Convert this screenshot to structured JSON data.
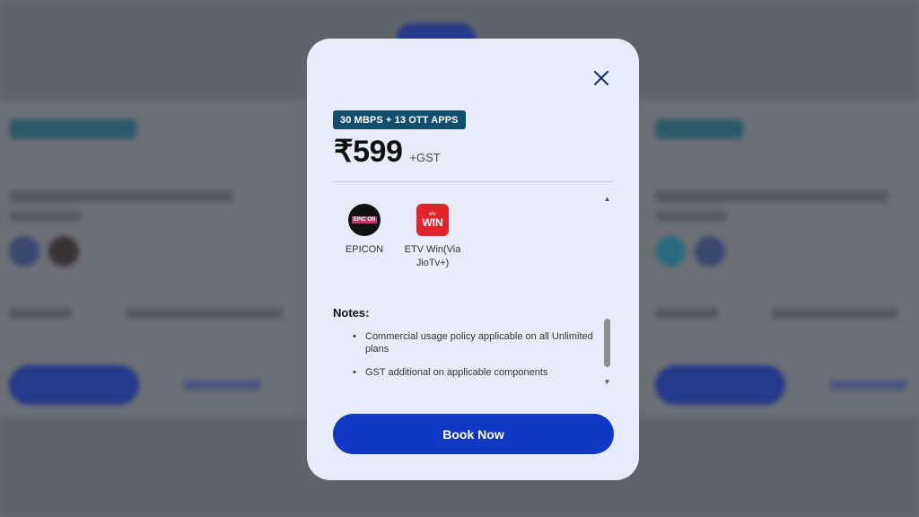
{
  "modal": {
    "plan_tag": "30 MBPS + 13 OTT APPS",
    "price": "₹599",
    "price_suffix": "+GST",
    "apps": [
      {
        "name": "EPICON",
        "icon": "epicon-logo-icon"
      },
      {
        "name": "ETV Win(Via JioTv+)",
        "icon": "etv-win-logo-icon"
      }
    ],
    "notes_title": "Notes:",
    "notes": [
      "Commercial usage policy applicable on all Unlimited plans",
      "GST additional on applicable components"
    ],
    "book_label": "Book Now"
  },
  "colors": {
    "accent": "#1038c4",
    "tag_bg": "#134e6f",
    "modal_bg": "#e8ecf8"
  }
}
